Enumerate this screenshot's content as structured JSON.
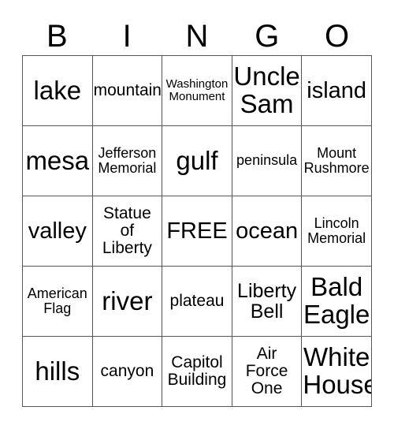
{
  "card": {
    "title": "BINGO",
    "header_letters": [
      "B",
      "I",
      "N",
      "G",
      "O"
    ],
    "free_space_label": "FREE",
    "colors": {
      "text": "#000000",
      "border": "#555555",
      "background": "#ffffff"
    },
    "rows": [
      [
        {
          "label": "lake",
          "size": "t-xxl"
        },
        {
          "label": "mountain",
          "size": "t-md"
        },
        {
          "label": "Washington\nMonument",
          "size": "t-xs"
        },
        {
          "label": "Uncle\nSam",
          "size": "t-xxl"
        },
        {
          "label": "island",
          "size": "t-xl"
        }
      ],
      [
        {
          "label": "mesa",
          "size": "t-xxl"
        },
        {
          "label": "Jefferson\nMemorial",
          "size": "t-sm"
        },
        {
          "label": "gulf",
          "size": "t-xxl"
        },
        {
          "label": "peninsula",
          "size": "t-sm"
        },
        {
          "label": "Mount\nRushmore",
          "size": "t-sm"
        }
      ],
      [
        {
          "label": "valley",
          "size": "t-xl"
        },
        {
          "label": "Statue\nof\nLiberty",
          "size": "t-md"
        },
        {
          "label": "FREE",
          "size": "t-xl"
        },
        {
          "label": "ocean",
          "size": "t-xl"
        },
        {
          "label": "Lincoln\nMemorial",
          "size": "t-sm"
        }
      ],
      [
        {
          "label": "American\nFlag",
          "size": "t-sm"
        },
        {
          "label": "river",
          "size": "t-xxl"
        },
        {
          "label": "plateau",
          "size": "t-md"
        },
        {
          "label": "Liberty\nBell",
          "size": "t-lg"
        },
        {
          "label": "Bald\nEagle",
          "size": "t-xxl"
        }
      ],
      [
        {
          "label": "hills",
          "size": "t-xxl"
        },
        {
          "label": "canyon",
          "size": "t-md"
        },
        {
          "label": "Capitol\nBuilding",
          "size": "t-md"
        },
        {
          "label": "Air\nForce\nOne",
          "size": "t-md"
        },
        {
          "label": "White\nHouse",
          "size": "t-xxl"
        }
      ]
    ]
  }
}
